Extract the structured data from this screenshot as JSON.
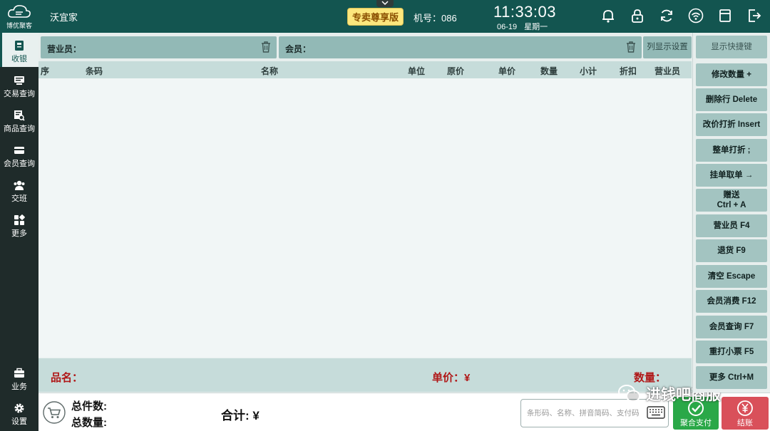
{
  "app": {
    "logo_text": "博优聚客",
    "store_name": "沃宜家",
    "edition": "专卖尊享版",
    "machine": "机号：086",
    "time": "11:33:03",
    "date": "06-19",
    "weekday": "星期一"
  },
  "top_icons": [
    "bell-icon",
    "lock-icon",
    "refresh-icon",
    "wifi-icon",
    "minimize-window-icon",
    "exit-icon"
  ],
  "nav": {
    "items": [
      {
        "label": "收银",
        "icon": "cashier-icon",
        "active": true
      },
      {
        "label": "交易查询",
        "icon": "transaction-icon"
      },
      {
        "label": "商品查询",
        "icon": "product-icon"
      },
      {
        "label": "会员查询",
        "icon": "member-card-icon"
      },
      {
        "label": "交班",
        "icon": "shift-icon"
      },
      {
        "label": "更多",
        "icon": "more-grid-icon"
      }
    ],
    "bottom_items": [
      {
        "label": "业务",
        "icon": "business-icon"
      },
      {
        "label": "设置",
        "icon": "settings-icon"
      }
    ]
  },
  "selectors": {
    "salesperson_label": "营业员：",
    "member_label": "会员：",
    "column_settings": "列显示设置"
  },
  "table": {
    "columns": [
      "序",
      "条码",
      "名称",
      "单位",
      "原价",
      "单价",
      "数量",
      "小计",
      "折扣",
      "营业员"
    ],
    "rows": []
  },
  "item_info": {
    "name_label": "品名：",
    "price_label": "单价：¥",
    "qty_label": "数量："
  },
  "totals": {
    "total_items_label": "总件数:",
    "total_qty_label": "总数量:",
    "sum_label": "合计: ¥"
  },
  "search": {
    "placeholder": "条形码、名称、拼音简码、支付码"
  },
  "payment": {
    "aggregate_label": "聚合支付",
    "checkout_label": "结账"
  },
  "shortcuts": {
    "header": "显示快捷键",
    "buttons": [
      "修改数量 +",
      "删除行 Delete",
      "改价打折 Insert",
      "整单打折 ;",
      "挂单取单 →",
      "赠送\nCtrl + A",
      "营业员 F4",
      "退货 F9",
      "清空 Escape",
      "会员消费 F12",
      "会员查询 F7",
      "重打小票 F5",
      "更多 Ctrl+M"
    ]
  },
  "watermark": "进钱吧商服",
  "colors": {
    "topbar": "#135550",
    "nav": "#1f2b2a",
    "accent_red": "#b01818",
    "pay_green": "#2aa848",
    "pay_red": "#d9505a"
  }
}
